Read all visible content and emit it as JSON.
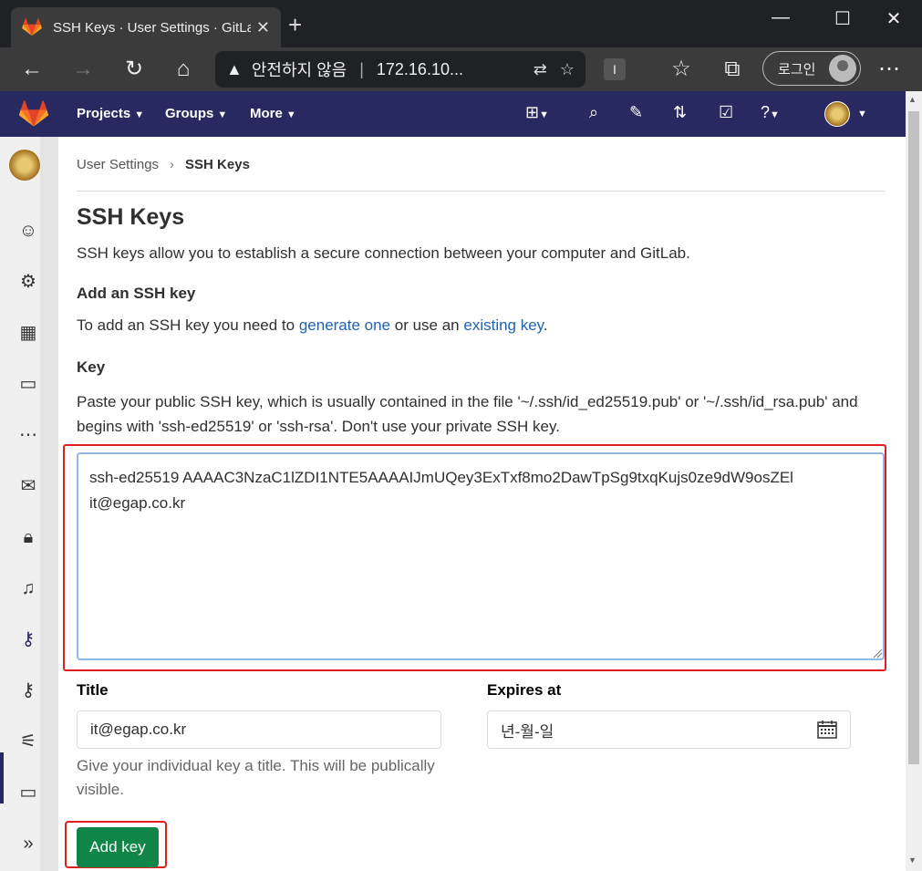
{
  "browser": {
    "tab_title": "SSH Keys · User Settings · GitLab",
    "tab_close": "✕",
    "new_tab": "+",
    "minimize": "—",
    "maximize": "☐",
    "close": "✕",
    "security_warning": "안전하지 않음",
    "url": "172.16.10...",
    "login_label": "로그인",
    "more_menu": "⋯"
  },
  "gitlab_nav": {
    "menus": [
      "Projects",
      "Groups",
      "More"
    ],
    "icons": [
      "plus-icon",
      "search-icon",
      "issues-icon",
      "merge-request-icon",
      "todo-icon",
      "help-icon",
      "user-avatar"
    ]
  },
  "sidebar": {
    "items": [
      "profile-icon",
      "account-icon",
      "applications-icon",
      "chat-icon",
      "access-tokens-icon",
      "emails-icon",
      "password-icon",
      "notifications-icon",
      "ssh-keys-icon",
      "gpg-keys-icon",
      "preferences-icon",
      "active-sessions-icon",
      "collapse-icon"
    ],
    "active": "ssh-keys-icon"
  },
  "breadcrumb": {
    "parent": "User Settings",
    "current": "SSH Keys"
  },
  "page": {
    "title": "SSH Keys",
    "description": "SSH keys allow you to establish a secure connection between your computer and GitLab.",
    "add_heading": "Add an SSH key",
    "add_text_1": "To add an SSH key you need to ",
    "generate_link": "generate one",
    "add_text_2": " or use an ",
    "existing_link": "existing key",
    "add_text_3": "."
  },
  "form": {
    "key_label": "Key",
    "key_help": "Paste your public SSH key, which is usually contained in the file '~/.ssh/id_ed25519.pub' or '~/.ssh/id_rsa.pub' and begins with 'ssh-ed25519' or 'ssh-rsa'. Don't use your private SSH key.",
    "key_value": "ssh-ed25519 AAAAC3NzaC1lZDI1NTE5AAAAIJmUQey3ExTxf8mo2DawTpSg9txqKujs0ze9dW9osZEl it@egap.co.kr",
    "title_label": "Title",
    "title_value": "it@egap.co.kr",
    "title_help": "Give your individual key a title. This will be publically visible.",
    "expires_label": "Expires at",
    "expires_value": "년-월-일",
    "submit_label": "Add key"
  },
  "colors": {
    "gitlab_nav": "#292961",
    "submit_button": "#108548",
    "link": "#1f64b0",
    "highlight": "#e01e1e"
  }
}
